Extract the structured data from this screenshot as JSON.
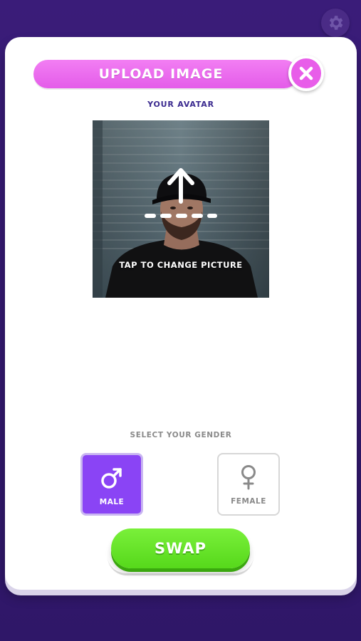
{
  "modal": {
    "title": "UPLOAD IMAGE",
    "close_icon": "close-icon",
    "avatar_label": "YOUR AVATAR",
    "avatar_hint": "TAP TO CHANGE PICTURE",
    "gender_label": "SELECT YOUR GENDER",
    "genders": [
      {
        "label": "MALE",
        "icon": "male-icon",
        "selected": true
      },
      {
        "label": "FEMALE",
        "icon": "female-icon",
        "selected": false
      }
    ],
    "swap_label": "SWAP"
  },
  "header": {
    "settings_icon": "gear-icon"
  },
  "colors": {
    "background": "#3a1c79",
    "title_pink": "#e85de9",
    "selected_purple": "#8a44f5",
    "swap_green": "#5fdc21",
    "label_blue": "#3b2a8f"
  }
}
